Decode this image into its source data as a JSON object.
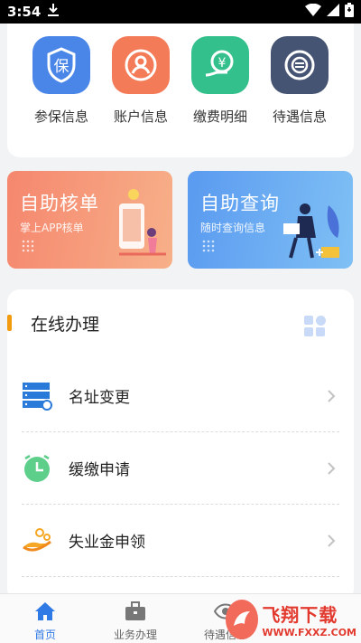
{
  "status_bar": {
    "time": "3:54"
  },
  "quick_actions": [
    {
      "label": "参保信息",
      "icon": "shield-bao-icon",
      "glyph": "保",
      "color": "#4a86e8"
    },
    {
      "label": "账户信息",
      "icon": "user-account-icon",
      "color": "#f47b58"
    },
    {
      "label": "缴费明细",
      "icon": "payment-yen-icon",
      "glyph": "¥",
      "color": "#34c08d"
    },
    {
      "label": "待遇信息",
      "icon": "benefit-coin-icon",
      "color": "#465473"
    }
  ],
  "banners": [
    {
      "title": "自助核单",
      "subtitle": "掌上APP核单",
      "color": "#f59075"
    },
    {
      "title": "自助查询",
      "subtitle": "随时查询信息",
      "color": "#5aa2f0"
    }
  ],
  "online_section": {
    "title": "在线办理",
    "items": [
      {
        "label": "名址变更",
        "icon": "server-change-icon"
      },
      {
        "label": "缓缴申请",
        "icon": "clock-icon"
      },
      {
        "label": "失业金申领",
        "icon": "hand-coins-icon"
      }
    ]
  },
  "bottom_nav": [
    {
      "label": "首页",
      "icon": "home-icon",
      "active": true
    },
    {
      "label": "业务办理",
      "icon": "briefcase-icon",
      "active": false
    },
    {
      "label": "待遇信息",
      "icon": "eye-icon",
      "active": false
    }
  ],
  "watermark": {
    "title": "飞翔下载",
    "subtitle": "WWW.FXXZ.COM"
  }
}
